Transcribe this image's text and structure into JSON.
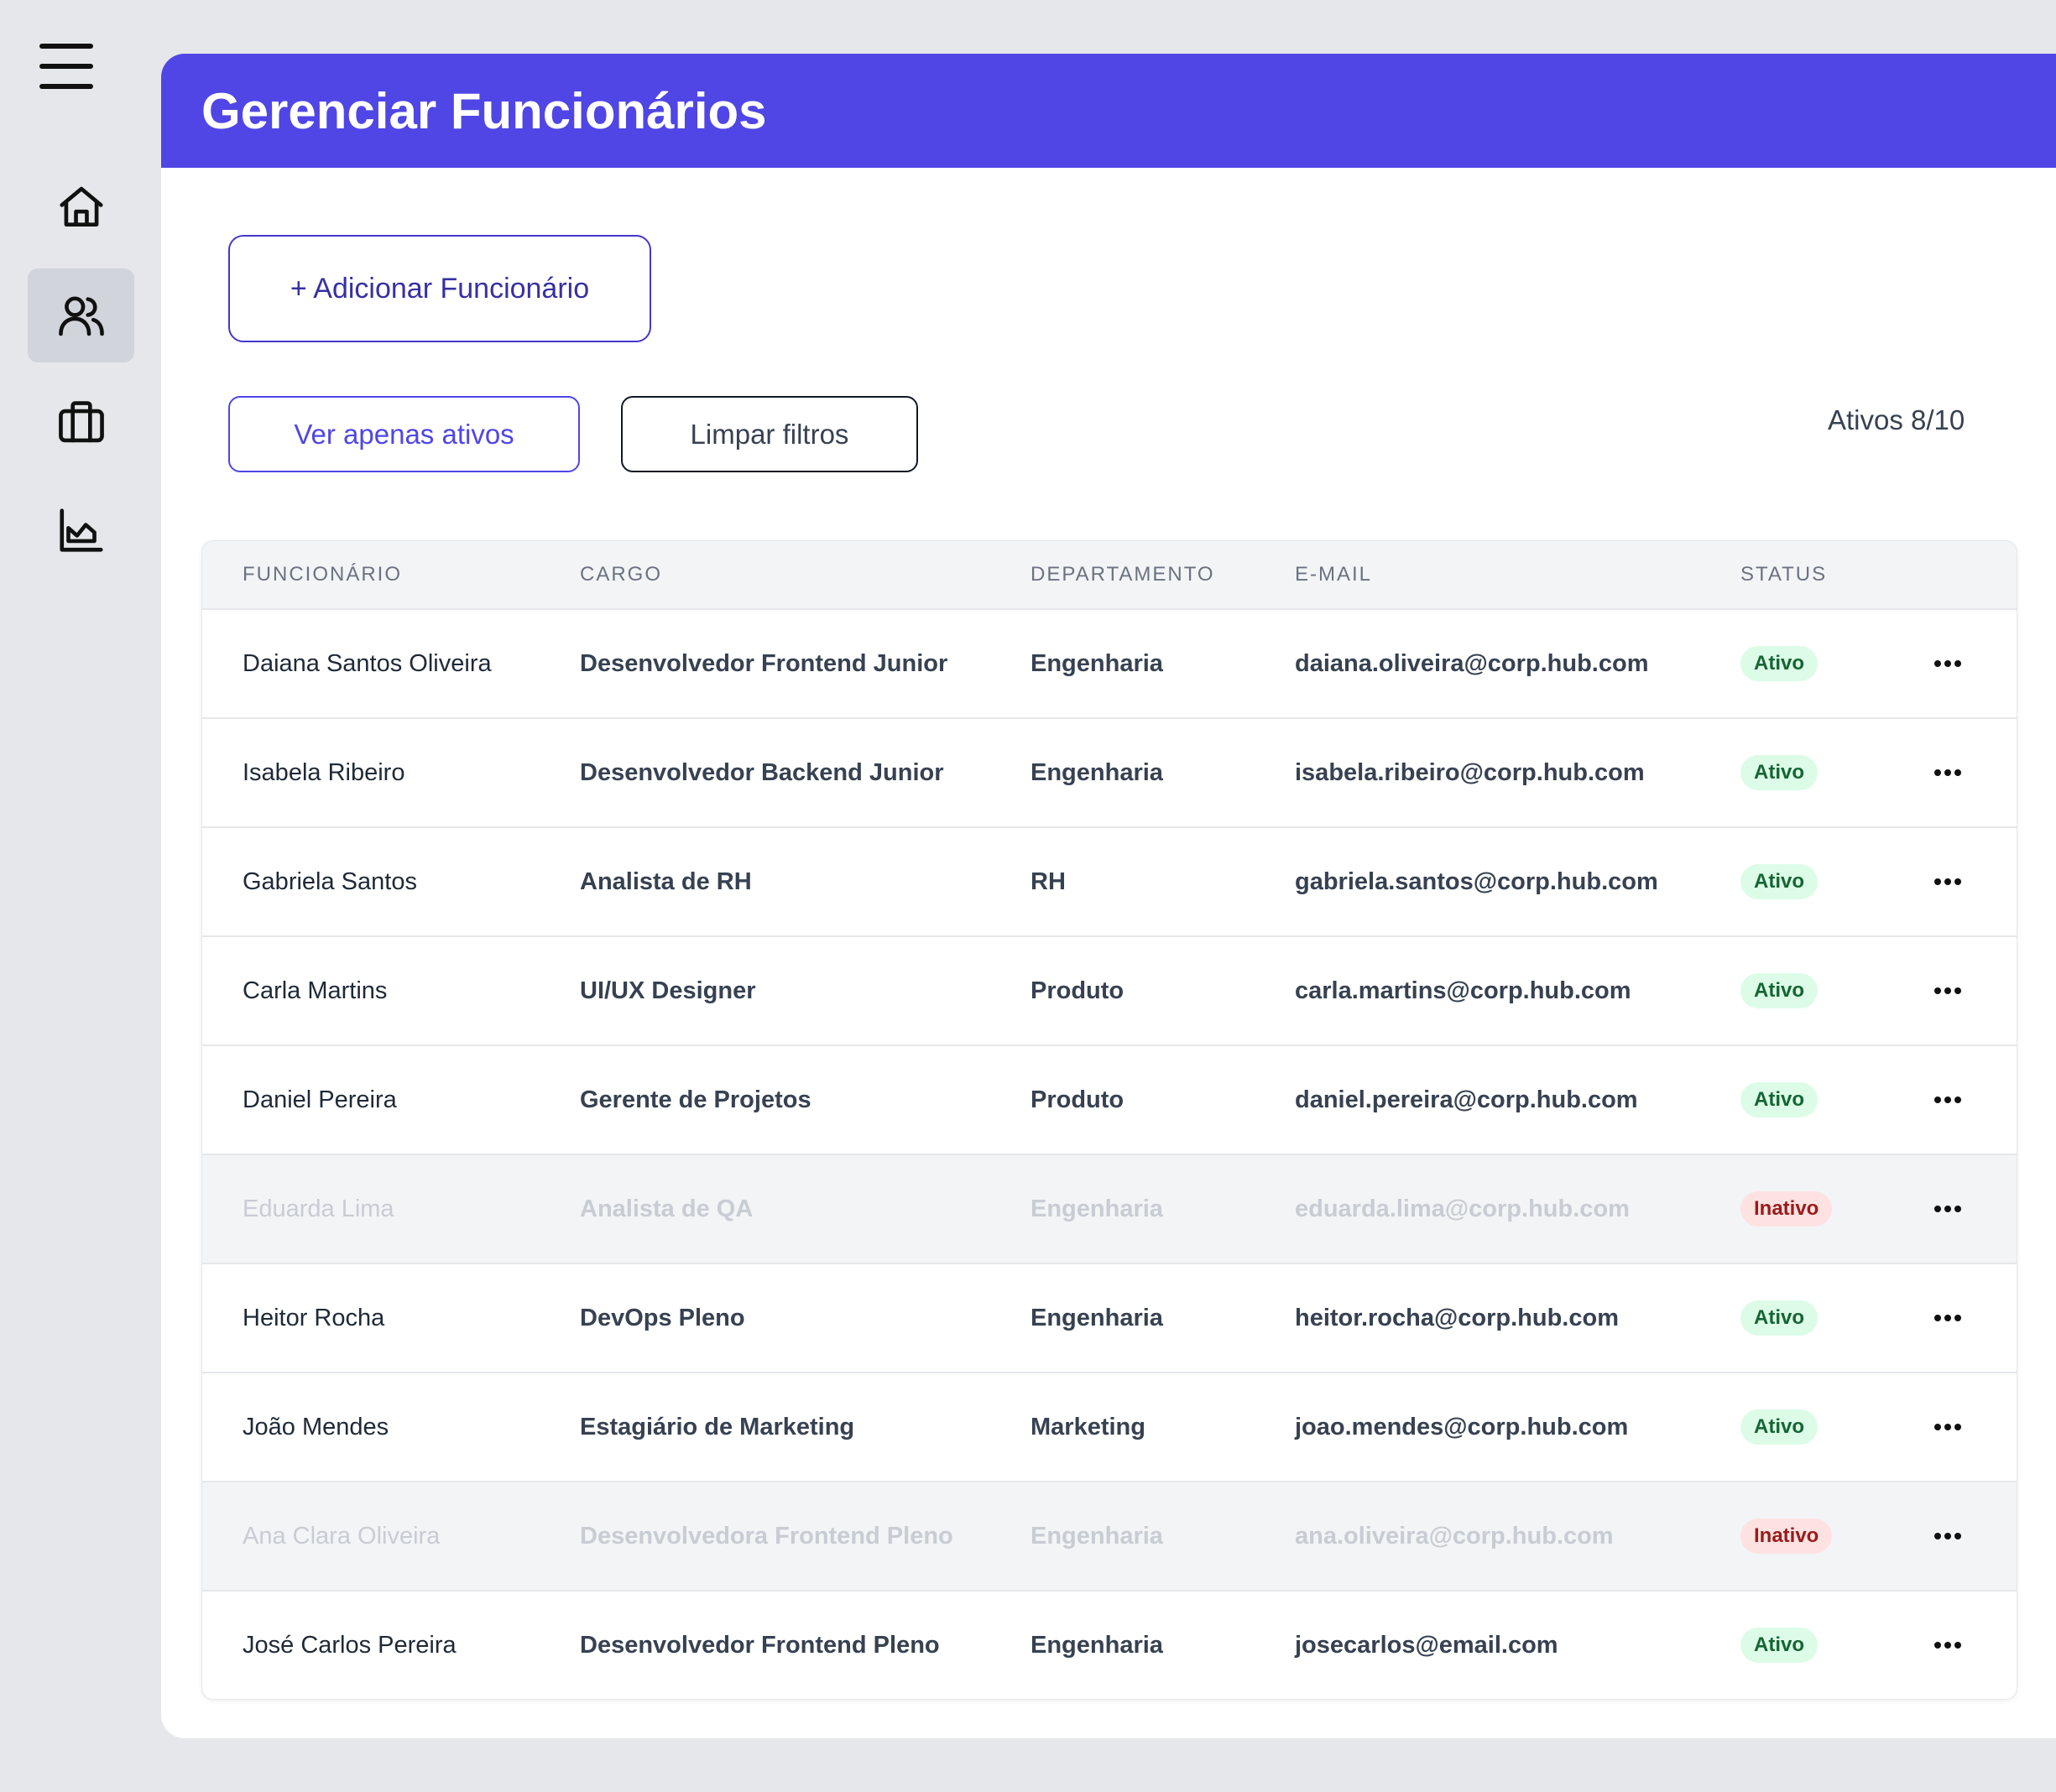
{
  "header": {
    "title": "Gerenciar Funcionários"
  },
  "sidebar": {
    "items": [
      {
        "name": "home",
        "icon": "home-icon"
      },
      {
        "name": "employees",
        "icon": "users-icon",
        "active": true
      },
      {
        "name": "jobs",
        "icon": "briefcase-icon"
      },
      {
        "name": "reports",
        "icon": "chart-icon"
      }
    ]
  },
  "toolbar": {
    "add_label": "+ Adicionar Funcionário",
    "filter_active_label": "Ver apenas ativos",
    "clear_filters_label": "Limpar filtros",
    "active_count": "Ativos 8/10"
  },
  "table": {
    "columns": [
      "FUNCIONÁRIO",
      "CARGO",
      "DEPARTAMENTO",
      "E-MAIL",
      "STATUS"
    ],
    "rows": [
      {
        "name": "Daiana Santos Oliveira",
        "role": "Desenvolvedor Frontend Junior",
        "department": "Engenharia",
        "email": "daiana.oliveira@corp.hub.com",
        "status": "Ativo",
        "active": true
      },
      {
        "name": "Isabela Ribeiro",
        "role": "Desenvolvedor Backend Junior",
        "department": "Engenharia",
        "email": "isabela.ribeiro@corp.hub.com",
        "status": "Ativo",
        "active": true
      },
      {
        "name": "Gabriela Santos",
        "role": "Analista de RH",
        "department": "RH",
        "email": "gabriela.santos@corp.hub.com",
        "status": "Ativo",
        "active": true
      },
      {
        "name": "Carla Martins",
        "role": "UI/UX Designer",
        "department": "Produto",
        "email": "carla.martins@corp.hub.com",
        "status": "Ativo",
        "active": true
      },
      {
        "name": "Daniel Pereira",
        "role": "Gerente de Projetos",
        "department": "Produto",
        "email": "daniel.pereira@corp.hub.com",
        "status": "Ativo",
        "active": true
      },
      {
        "name": "Eduarda Lima",
        "role": "Analista de QA",
        "department": "Engenharia",
        "email": "eduarda.lima@corp.hub.com",
        "status": "Inativo",
        "active": false
      },
      {
        "name": "Heitor Rocha",
        "role": "DevOps Pleno",
        "department": "Engenharia",
        "email": "heitor.rocha@corp.hub.com",
        "status": "Ativo",
        "active": true
      },
      {
        "name": "João Mendes",
        "role": "Estagiário de Marketing",
        "department": "Marketing",
        "email": "joao.mendes@corp.hub.com",
        "status": "Ativo",
        "active": true
      },
      {
        "name": "Ana Clara Oliveira",
        "role": "Desenvolvedora Frontend Pleno",
        "department": "Engenharia",
        "email": "ana.oliveira@corp.hub.com",
        "status": "Inativo",
        "active": false
      },
      {
        "name": "José Carlos Pereira",
        "role": "Desenvolvedor Frontend Pleno",
        "department": "Engenharia",
        "email": "josecarlos@email.com",
        "status": "Ativo",
        "active": true
      }
    ]
  }
}
